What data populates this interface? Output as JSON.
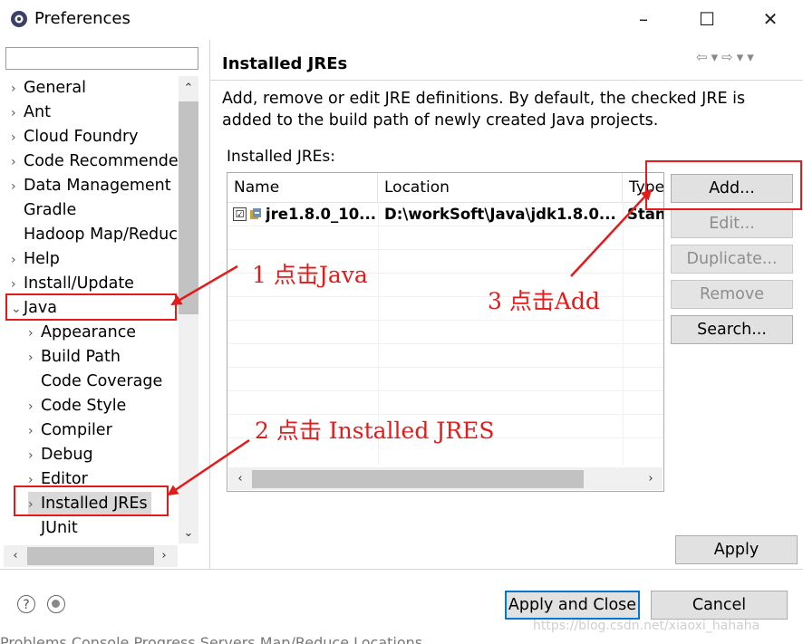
{
  "window": {
    "title": "Preferences",
    "minimize": "–",
    "maximize": "☐",
    "close": "✕"
  },
  "tree": {
    "items": [
      {
        "label": "General",
        "chevron": "›"
      },
      {
        "label": "Ant",
        "chevron": "›"
      },
      {
        "label": "Cloud Foundry",
        "chevron": "›"
      },
      {
        "label": "Code Recommenders",
        "chevron": "›"
      },
      {
        "label": "Data Management",
        "chevron": "›"
      },
      {
        "label": "Gradle",
        "chevron": ""
      },
      {
        "label": "Hadoop Map/Reduce",
        "chevron": ""
      },
      {
        "label": "Help",
        "chevron": "›"
      },
      {
        "label": "Install/Update",
        "chevron": "›"
      },
      {
        "label": "Java",
        "chevron": "⌄"
      },
      {
        "label": "Appearance",
        "chevron": "›"
      },
      {
        "label": "Build Path",
        "chevron": "›"
      },
      {
        "label": "Code Coverage",
        "chevron": ""
      },
      {
        "label": "Code Style",
        "chevron": "›"
      },
      {
        "label": "Compiler",
        "chevron": "›"
      },
      {
        "label": "Debug",
        "chevron": "›"
      },
      {
        "label": "Editor",
        "chevron": "›"
      },
      {
        "label": "Installed JREs",
        "chevron": "›"
      },
      {
        "label": "JUnit",
        "chevron": ""
      }
    ]
  },
  "page": {
    "title": "Installed JREs",
    "description": "Add, remove or edit JRE definitions. By default, the checked JRE is added to the build path of newly created Java projects.",
    "table_label": "Installed JREs:",
    "columns": [
      "Name",
      "Location",
      "Type"
    ],
    "rows": [
      {
        "name": "jre1.8.0_10...",
        "location": "D:\\workSoft\\Java\\jdk1.8.0...",
        "type": "Stan",
        "checked": "☑"
      }
    ]
  },
  "buttons": {
    "add": "Add...",
    "edit": "Edit...",
    "duplicate": "Duplicate...",
    "remove": "Remove",
    "search": "Search...",
    "apply": "Apply",
    "apply_close": "Apply and Close",
    "cancel": "Cancel"
  },
  "annotations": {
    "step1": "1 点击Java",
    "step2": "2 点击 Installed JRES",
    "step3": "3 点击Add"
  },
  "watermark": "https://blog.csdn.net/xiaoxi_hahaha",
  "bottom_tabs": "Problems  Console  Progress  Servers  Map/Reduce Locations",
  "colors": {
    "annotation": "#e31b1b",
    "primary_border": "#0078d7",
    "scroll_thumb": "#c2c2c2"
  }
}
